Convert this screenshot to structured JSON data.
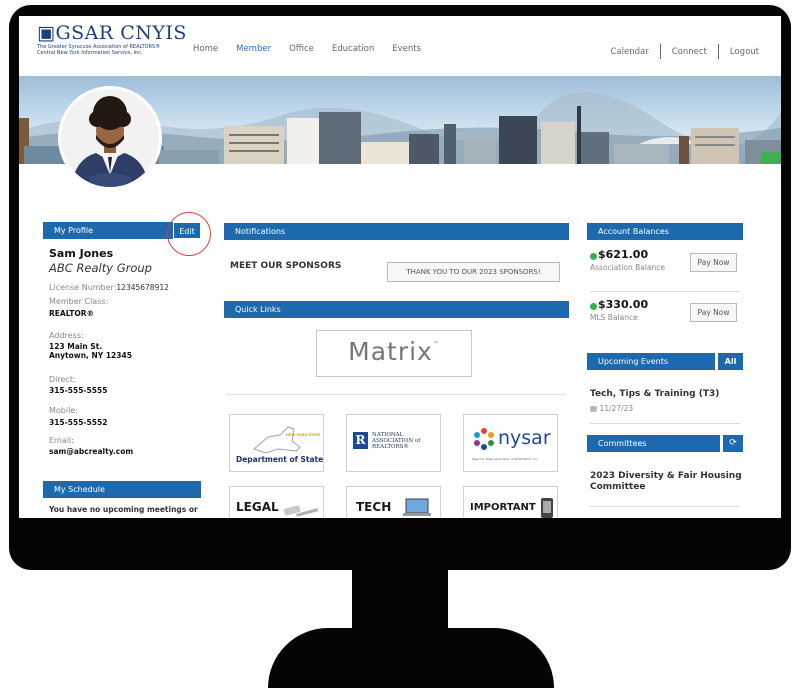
{
  "header": {
    "logo_main": "GSAR CNYIS",
    "logo_line1": "The Greater Syracuse Association of REALTORS®",
    "logo_line2": "Central New York Information Service, Inc.",
    "nav_left": [
      "Home",
      "Member",
      "Office",
      "Education",
      "Events"
    ],
    "nav_right": [
      "Calendar",
      "Connect",
      "Logout"
    ]
  },
  "profile": {
    "section_title": "My Profile",
    "edit_label": "Edit",
    "name": "Sam Jones",
    "company": "ABC Realty Group",
    "license_label": "License Number:",
    "license_number": "12345678912",
    "member_class_label": "Member Class:",
    "member_class": "REALTOR®",
    "address_label": "Address:",
    "address_line1": "123 Main St.",
    "address_line2": "Anytown, NY 12345",
    "direct_label": "Direct:",
    "direct": "315-555-5555",
    "mobile_label": "Mobile:",
    "mobile": "315-555-5552",
    "email_label": "Email:",
    "email": "sam@abcrealty.com"
  },
  "schedule": {
    "section_title": "My Schedule",
    "empty_text": "You have no upcoming meetings or"
  },
  "notifications": {
    "section_title": "Notifications",
    "sponsor_title": "MEET OUR SPONSORS",
    "sponsor_button": "THANK YOU TO OUR 2023 SPONSORS!"
  },
  "quick_links": {
    "section_title": "Quick Links",
    "matrix_label": "Matrix",
    "matrix_tm": "™",
    "tiles": {
      "dos_ny": "NEW YORK STATE",
      "dos_label": "Department of State",
      "nar_line1": "NATIONAL",
      "nar_line2": "ASSOCIATION of",
      "nar_line3": "REALTORS®",
      "nysar_label": "nysar",
      "nysar_sub": "New York State Association of REALTORS®, Inc.",
      "legal_label": "LEGAL",
      "tech_label": "TECH",
      "important_label": "IMPORTANT"
    }
  },
  "accounts": {
    "section_title": "Account Balances",
    "balances": [
      {
        "amount": "$621.00",
        "label": "Association Balance",
        "button": "Pay Now"
      },
      {
        "amount": "$330.00",
        "label": "MLS Balance",
        "button": "Pay Now"
      }
    ],
    "status_color": "#2fb34a"
  },
  "events": {
    "section_title": "Upcoming Events",
    "all_label": "All",
    "event_title": "Tech, Tips & Training (T3)",
    "event_date": "11/27/23"
  },
  "committees": {
    "section_title": "Committees",
    "refresh_icon": "refresh-icon",
    "committee_title": "2023 Diversity & Fair Housing Committee"
  },
  "colors": {
    "accent": "#1d69ad",
    "brand": "#1e3f7d",
    "highlight": "#e03a3a"
  }
}
